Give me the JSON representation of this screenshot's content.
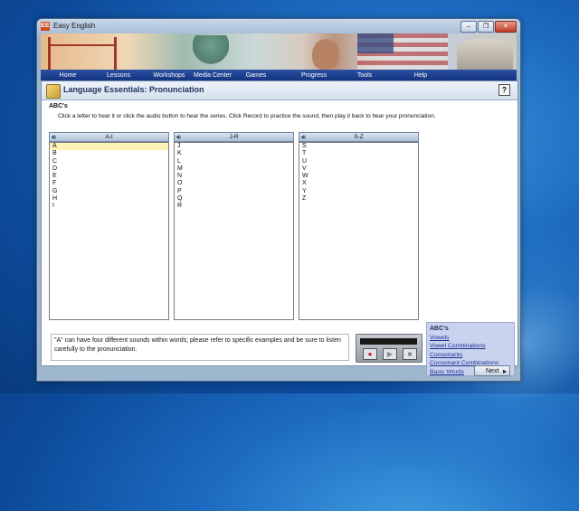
{
  "window": {
    "title": "Easy English",
    "icon_text": "EE",
    "controls": [
      "minimize",
      "restore",
      "close"
    ]
  },
  "nav": [
    "Home",
    "Lessons",
    "Workshops",
    "Media Center",
    "Games",
    "Progress",
    "Tools",
    "Help"
  ],
  "page": {
    "title": "Language Essentials: Pronunciation",
    "help_label": "?",
    "section_title": "ABC's",
    "instructions": "Click a letter to hear it or click the audio button to hear the series. Click Record to practice the sound, then play it back to hear your pronunciation."
  },
  "panels": [
    {
      "label": "A-I",
      "letters": [
        "A",
        "B",
        "C",
        "D",
        "E",
        "F",
        "G",
        "H",
        "I"
      ],
      "selected": "A"
    },
    {
      "label": "J-R",
      "letters": [
        "J",
        "K",
        "L",
        "M",
        "N",
        "O",
        "P",
        "Q",
        "R"
      ]
    },
    {
      "label": "S-Z",
      "letters": [
        "S",
        "T",
        "U",
        "V",
        "W",
        "X",
        "Y",
        "Z"
      ]
    }
  ],
  "note": "\"A\" can have four different sounds within words; please refer to specific examples and be sure to listen carefully to the pronunciation.",
  "recorder": {
    "record": "●",
    "play": "▶",
    "stop": "■"
  },
  "toc": {
    "title": "ABC's",
    "links": [
      "Vowels",
      "Vowel Combinations",
      "Consonants",
      "Consonant Combinations",
      "Basic Words"
    ]
  },
  "next_button": {
    "label": "Next",
    "arrow": "▸"
  },
  "colors": {
    "nav_bg": "#14357f",
    "selected_row": "#fef3b4",
    "toc_bg": "#c9d3ee",
    "link": "#1f2f98"
  }
}
